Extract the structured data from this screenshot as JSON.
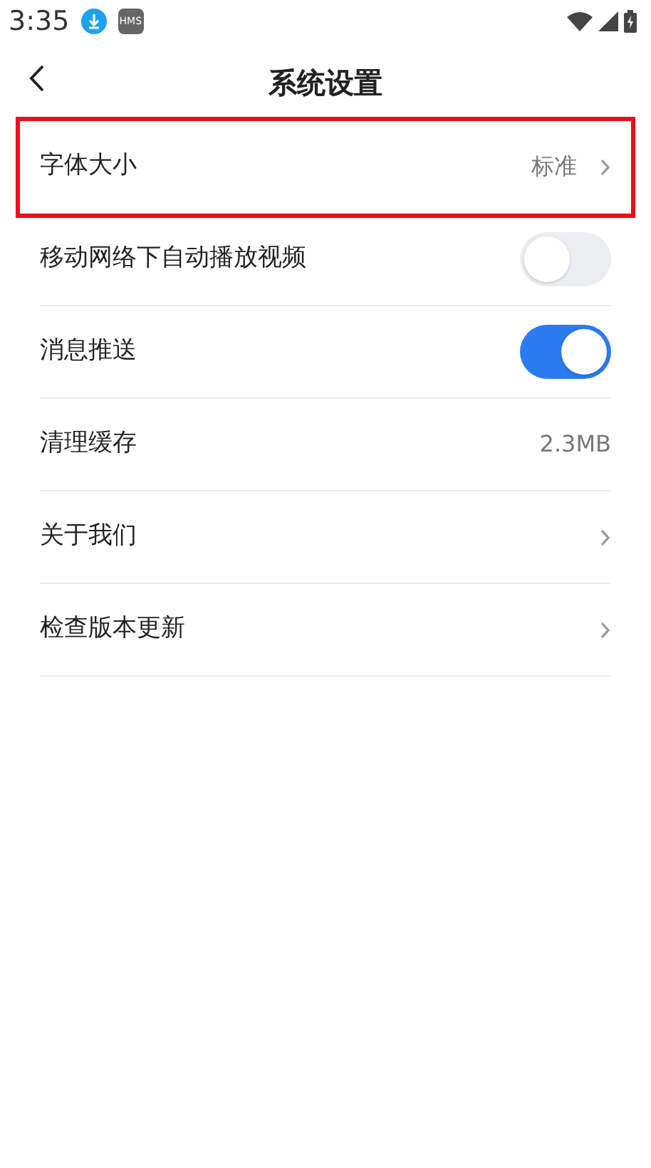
{
  "status_bar": {
    "time": "3:35",
    "badge": "HMS"
  },
  "header": {
    "title": "系统设置"
  },
  "settings": [
    {
      "kind": "link",
      "label": "字体大小",
      "value": "标准",
      "highlighted": true
    },
    {
      "kind": "toggle",
      "label": "移动网络下自动播放视频",
      "on": false
    },
    {
      "kind": "toggle",
      "label": "消息推送",
      "on": true
    },
    {
      "kind": "value",
      "label": "清理缓存",
      "value": "2.3MB"
    },
    {
      "kind": "link",
      "label": "关于我们"
    },
    {
      "kind": "link",
      "label": "检查版本更新"
    }
  ]
}
